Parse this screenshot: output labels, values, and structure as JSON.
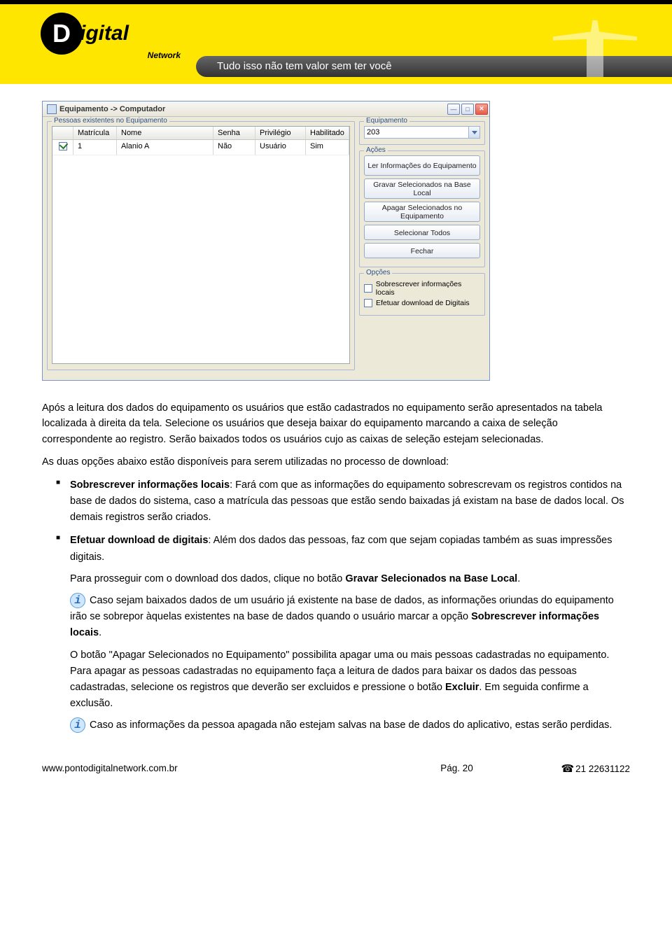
{
  "header": {
    "logo_letter": "D",
    "logo_rest": "igital",
    "logo_sub": "Network",
    "slogan": "Tudo isso não tem valor sem ter você"
  },
  "dialog": {
    "title": "Equipamento -> Computador",
    "group_people": "Pessoas existentes no Equipamento",
    "columns": {
      "matricula": "Matrícula",
      "nome": "Nome",
      "senha": "Senha",
      "privilegio": "Privilégio",
      "habilitado": "Habilitado"
    },
    "row": {
      "matricula": "1",
      "nome": "Alanio A",
      "senha": "Não",
      "privilegio": "Usuário",
      "habilitado": "Sim"
    },
    "equipamento_label": "Equipamento",
    "equipamento_value": "203",
    "acoes_label": "Ações",
    "btn_ler": "Ler Informações do\nEquipamento",
    "btn_gravar": "Gravar Selecionados na Base\nLocal",
    "btn_apagar": "Apagar Selecionados no\nEquipamento",
    "btn_selecionar": "Selecionar Todos",
    "btn_fechar": "Fechar",
    "opcoes_label": "Opções",
    "opt_sobrescrever": "Sobrescrever informações locais",
    "opt_download": "Efetuar download de Digitais"
  },
  "text": {
    "p1": "Após a leitura dos dados do equipamento os usuários que estão cadastrados no equipamento serão apresentados na tabela localizada à direita da tela. Selecione os usuários que deseja baixar do equipamento marcando a caixa de seleção correspondente ao registro. Serão baixados todos os usuários cujo as caixas de seleção estejam selecionadas.",
    "p2": "As duas opções abaixo estão disponíveis para serem utilizadas no processo de download:",
    "li1_bold": "Sobrescrever informações locais",
    "li1_rest": ": Fará com que as informações do equipamento sobrescrevam os registros contidos na base de dados do sistema, caso a matrícula das pessoas que estão sendo baixadas já existam na base de dados local. Os demais registros serão criados.",
    "li2_bold": "Efetuar download de digitais",
    "li2_rest": ": Além dos dados das pessoas, faz com que sejam copiadas também as suas impressões digitais.",
    "p3a": "Para prosseguir com o download dos dados, clique no botão ",
    "p3b": "Gravar Selecionados na Base Local",
    "p3c": ".",
    "p4a": "Caso sejam baixados dados de um usuário já existente na base de dados, as informações oriundas do equipamento irão se sobrepor àquelas existentes na base de dados quando o usuário marcar a opção ",
    "p4b": "Sobrescrever informações locais",
    "p4c": ".",
    "p5a": "O botão \"Apagar Selecionados no Equipamento\" possibilita apagar uma ou mais pessoas cadastradas no equipamento. Para apagar as pessoas cadastradas no equipamento faça a leitura de dados para baixar os dados das pessoas cadastradas, selecione os registros que deverão ser excluidos e pressione o botão ",
    "p5b": "Excluir",
    "p5c": ". Em seguida confirme a exclusão.",
    "p6": "Caso as informações da pessoa apagada não estejam salvas na base de dados do aplicativo, estas serão perdidas."
  },
  "footer": {
    "url": "www.pontodigitalnetwork.com.br",
    "pag_label": "Pág.",
    "pag_no": "20",
    "phone": "21 22631122"
  }
}
